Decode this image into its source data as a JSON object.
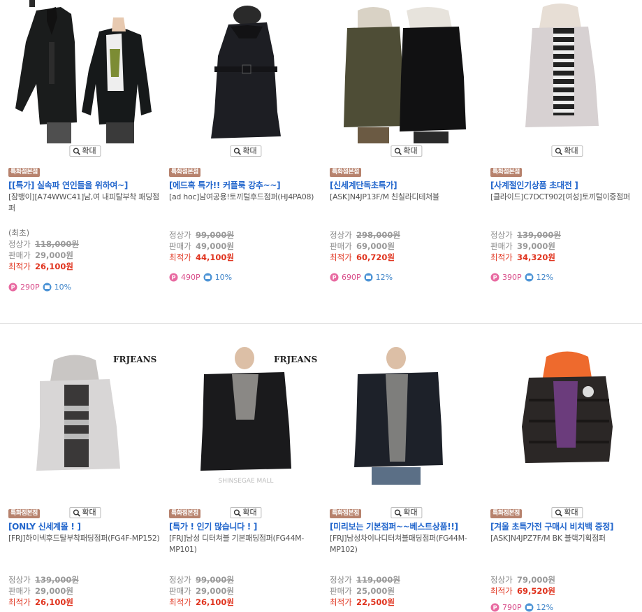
{
  "zoom_label": "확대",
  "badge_label": "특화점본점",
  "labels": {
    "regular": "정상가",
    "sale": "판매가",
    "best": "최적가",
    "lowest_note": "(최초)"
  },
  "colors": {
    "headline": "#2266cc",
    "best_price": "#e0331e",
    "badge_bg": "#b7826d",
    "points": "#d84a88",
    "rate": "#3b82c8"
  },
  "products": [
    {
      "headline": "[[특가] 실속파 연인들을 위하여~]",
      "name": "[잠뱅이][A74WWC41]남,여 내피탈부착 패딩점퍼",
      "note": "(최초)",
      "regular": "118,000원",
      "sale": "29,000원",
      "best": "26,100원",
      "points": "290P",
      "rate": "10%"
    },
    {
      "headline": "[에드혹 특가!! 커플룩 강추~~]",
      "name": "[ad hoc]남여공용!토끼털후드점퍼(HJ4PA08)",
      "regular": "99,000원",
      "sale": "49,000원",
      "best": "44,100원",
      "points": "490P",
      "rate": "10%"
    },
    {
      "headline": "[신세계단독초특가]",
      "name": "[ASK]N4JP13F/M 친칠라디테쳐블",
      "regular": "298,000원",
      "sale": "69,000원",
      "best": "60,720원",
      "points": "690P",
      "rate": "12%"
    },
    {
      "headline": "[사계절인기상품 초대전 ]",
      "name": "[클라이드]C7DCT902[여성]토끼털이중점퍼",
      "regular": "139,000원",
      "sale": "39,000원",
      "best": "34,320원",
      "points": "390P",
      "rate": "12%"
    },
    {
      "headline": "[ONLY 신세계몰 ! ]",
      "name": "[FRJ]하이넥후드탈부착패딩점퍼(FG4F-MP152)",
      "regular": "139,000원",
      "sale": "29,000원",
      "best": "26,100원"
    },
    {
      "headline": "[특가 ! 인기 많습니다 ! ]",
      "name": "[FRJ]남성 디터쳐블 기본패딩점퍼(FG44M-MP101)",
      "regular": "99,000원",
      "sale": "29,000원",
      "best": "26,100원"
    },
    {
      "headline": "[미리보는 기본점퍼~~베스트상품!!]",
      "name": "[FRJ]남성차이나디터쳐블패딩점퍼(FG44M-MP102)",
      "regular": "119,000원",
      "sale": "25,000원",
      "best": "22,500원"
    },
    {
      "headline": "[겨울 초특가전 구매시 비치백 증정]",
      "name": "[ASK]N4JPZ7F/M BK 블랙기획점퍼",
      "regular": "79,000원",
      "best": "69,520원",
      "points": "790P",
      "rate": "12%"
    }
  ],
  "brand_watermark": "FRJEANS",
  "photo_watermark": "SHINSEGAE MALL"
}
